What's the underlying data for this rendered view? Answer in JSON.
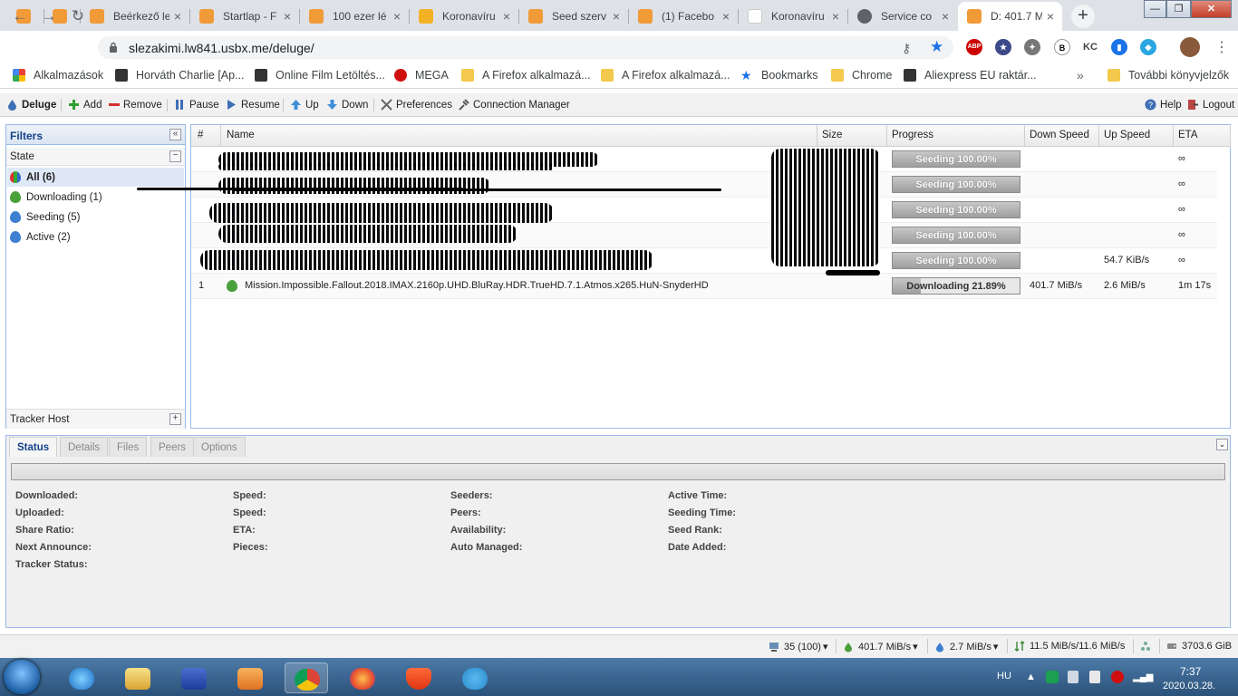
{
  "browser": {
    "tabs": [
      {
        "title": ""
      },
      {
        "title": ""
      },
      {
        "title": "Beérkező le"
      },
      {
        "title": "Startlap - F"
      },
      {
        "title": "100 ezer lé"
      },
      {
        "title": "Koronavíru"
      },
      {
        "title": "Seed szerv"
      },
      {
        "title": "(1) Facebo"
      },
      {
        "title": "Koronavíru"
      },
      {
        "title": "Service co"
      },
      {
        "title": "D: 401.7 M"
      }
    ],
    "url": "slezakimi.lw841.usbx.me/deluge/",
    "bookmarks": [
      {
        "label": "Alkalmazások",
        "icon": "apps-grid-icon"
      },
      {
        "label": "Horváth Charlie [Ap...",
        "icon": "site-icon"
      },
      {
        "label": "Online Film Letöltés...",
        "icon": "site-icon"
      },
      {
        "label": "MEGA",
        "icon": "mega-icon"
      },
      {
        "label": "A Firefox alkalmazá...",
        "icon": "folder-icon"
      },
      {
        "label": "A Firefox alkalmazá...",
        "icon": "folder-icon"
      },
      {
        "label": "Bookmarks",
        "icon": "star-icon"
      },
      {
        "label": "Chrome",
        "icon": "folder-icon"
      },
      {
        "label": "Aliexpress EU raktár...",
        "icon": "site-icon"
      }
    ],
    "more_bookmarks": "»",
    "other_bookmarks": "További könyvjelzők",
    "extensions": {
      "abp": "ABP",
      "b": "B",
      "kc": "KC"
    }
  },
  "deluge": {
    "toolbar": {
      "app": "Deluge",
      "add": "Add",
      "remove": "Remove",
      "pause": "Pause",
      "resume": "Resume",
      "up": "Up",
      "down": "Down",
      "preferences": "Preferences",
      "connection_manager": "Connection Manager",
      "help": "Help",
      "logout": "Logout"
    },
    "filters": {
      "title": "Filters",
      "state_label": "State",
      "items": [
        {
          "label": "All (6)"
        },
        {
          "label": "Downloading (1)"
        },
        {
          "label": "Seeding (5)"
        },
        {
          "label": "Active (2)"
        }
      ],
      "tracker_host": "Tracker Host"
    },
    "columns": [
      "#",
      "Name",
      "Size",
      "Progress",
      "Down Speed",
      "Up Speed",
      "ETA"
    ],
    "torrents": [
      {
        "num": "",
        "name": "",
        "progress_text": "Seeding 100.00%",
        "progress": 100,
        "down": "",
        "up": "",
        "eta": "∞"
      },
      {
        "num": "",
        "name": "",
        "progress_text": "Seeding 100.00%",
        "progress": 100,
        "down": "",
        "up": "",
        "eta": "∞"
      },
      {
        "num": "",
        "name": "",
        "progress_text": "Seeding 100.00%",
        "progress": 100,
        "down": "",
        "up": "",
        "eta": "∞"
      },
      {
        "num": "",
        "name": "",
        "progress_text": "Seeding 100.00%",
        "progress": 100,
        "down": "",
        "up": "",
        "eta": "∞"
      },
      {
        "num": "",
        "name": "",
        "progress_text": "Seeding 100.00%",
        "progress": 100,
        "down": "",
        "up": "54.7 KiB/s",
        "eta": "∞"
      },
      {
        "num": "1",
        "name": "Mission.Impossible.Fallout.2018.IMAX.2160p.UHD.BluRay.HDR.TrueHD.7.1.Atmos.x265.HuN-SnyderHD",
        "progress_text": "Downloading 21.89%",
        "progress": 21.89,
        "down": "401.7 MiB/s",
        "up": "2.6 MiB/s",
        "eta": "1m 17s"
      }
    ],
    "details": {
      "tabs": [
        "Status",
        "Details",
        "Files",
        "Peers",
        "Options"
      ],
      "labels": [
        [
          "Downloaded:",
          "Uploaded:",
          "Share Ratio:",
          "Next Announce:",
          "Tracker Status:"
        ],
        [
          "Speed:",
          "Speed:",
          "ETA:",
          "Pieces:"
        ],
        [
          "Seeders:",
          "Peers:",
          "Availability:",
          "Auto Managed:"
        ],
        [
          "Active Time:",
          "Seeding Time:",
          "Seed Rank:",
          "Date Added:"
        ]
      ]
    },
    "statusbar": {
      "connections": "35 (100)",
      "down": "401.7 MiB/s",
      "up": "2.7 MiB/s",
      "protocol": "11.5 MiB/s/11.6 MiB/s",
      "free_space": "3703.6 GiB"
    }
  },
  "taskbar": {
    "lang": "HU",
    "time": "7:37",
    "date": "2020.03.28."
  }
}
